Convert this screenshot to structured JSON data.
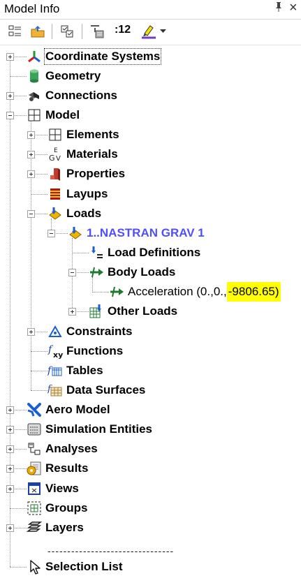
{
  "panel": {
    "title": "Model Info",
    "pin": "q",
    "close": "×"
  },
  "toolbar": {
    "zoom_label": ":12"
  },
  "tree": {
    "coordinate_systems": "Coordinate Systems",
    "geometry": "Geometry",
    "connections": "Connections",
    "model": "Model",
    "elements": "Elements",
    "materials": "Materials",
    "properties": "Properties",
    "layups": "Layups",
    "loads": "Loads",
    "load_set": "1..NASTRAN GRAV 1",
    "load_definitions": "Load Definitions",
    "body_loads": "Body Loads",
    "acceleration_prefix": "Acceleration (0.,0.,",
    "acceleration_value": "-9806.65)",
    "other_loads": "Other Loads",
    "constraints": "Constraints",
    "functions": "Functions",
    "tables": "Tables",
    "data_surfaces": "Data Surfaces",
    "aero_model": "Aero Model",
    "simulation_entities": "Simulation Entities",
    "analyses": "Analyses",
    "results": "Results",
    "views": "Views",
    "groups": "Groups",
    "layers": "Layers",
    "separator": "--------------------------------",
    "selection_list": "Selection List"
  },
  "colors": {
    "highlight": "#ffff00",
    "load_set_text": "#4f4fff"
  }
}
